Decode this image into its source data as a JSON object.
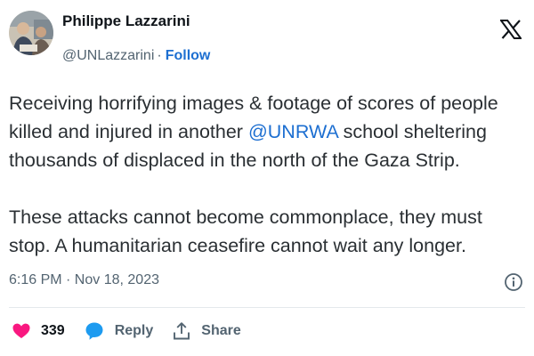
{
  "author": {
    "name": "Philippe Lazzarini",
    "handle": "@UNLazzarini",
    "separator": "·",
    "follow_label": "Follow"
  },
  "icons": {
    "logo": "x-logo-icon",
    "info": "info-icon",
    "like": "heart-icon",
    "reply": "speech-bubble-icon",
    "share": "share-upload-icon"
  },
  "tweet": {
    "line1": "Receiving horrifying images & footage of scores of people",
    "line2_before": "killed and injured in another ",
    "mention": "@UNRWA",
    "line2_after": " school sheltering",
    "line3": "thousands of displaced in the north of the Gaza Strip.",
    "line4": "These attacks cannot become commonplace, they must",
    "line5": "stop. A humanitarian ceasefire cannot wait any longer."
  },
  "timestamp": "6:16 PM · Nov 18, 2023",
  "actions": {
    "like_count": "339",
    "reply_label": "Reply",
    "share_label": "Share"
  },
  "colors": {
    "link": "#1d6fd1",
    "like": "#f91880",
    "reply": "#1d9bf0",
    "muted": "#536471",
    "text": "#0f1419"
  }
}
